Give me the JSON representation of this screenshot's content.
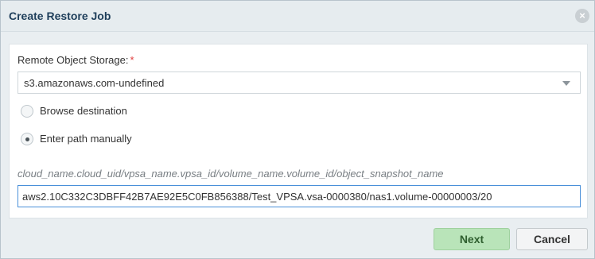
{
  "dialog": {
    "title": "Create Restore Job",
    "close_icon": "close-icon"
  },
  "form": {
    "storage_label": "Remote Object Storage:",
    "required_mark": "*",
    "storage_value": "s3.amazonaws.com-undefined",
    "radio_browse_label": "Browse destination",
    "radio_manual_label": "Enter path manually",
    "selected_option": "Enter path manually",
    "path_hint": "cloud_name.cloud_uid/vpsa_name.vpsa_id/volume_name.volume_id/object_snapshot_name",
    "path_value": "aws2.10C332C3DBFF42B7AE92E5C0FB856388/Test_VPSA.vsa-0000380/nas1.volume-00000003/20"
  },
  "buttons": {
    "next_label": "Next",
    "cancel_label": "Cancel"
  },
  "colors": {
    "title_text": "#1f3f5b",
    "next_button": "#b9e4b9",
    "required": "#e03b3b",
    "input_focus_border": "#4a90d9"
  }
}
